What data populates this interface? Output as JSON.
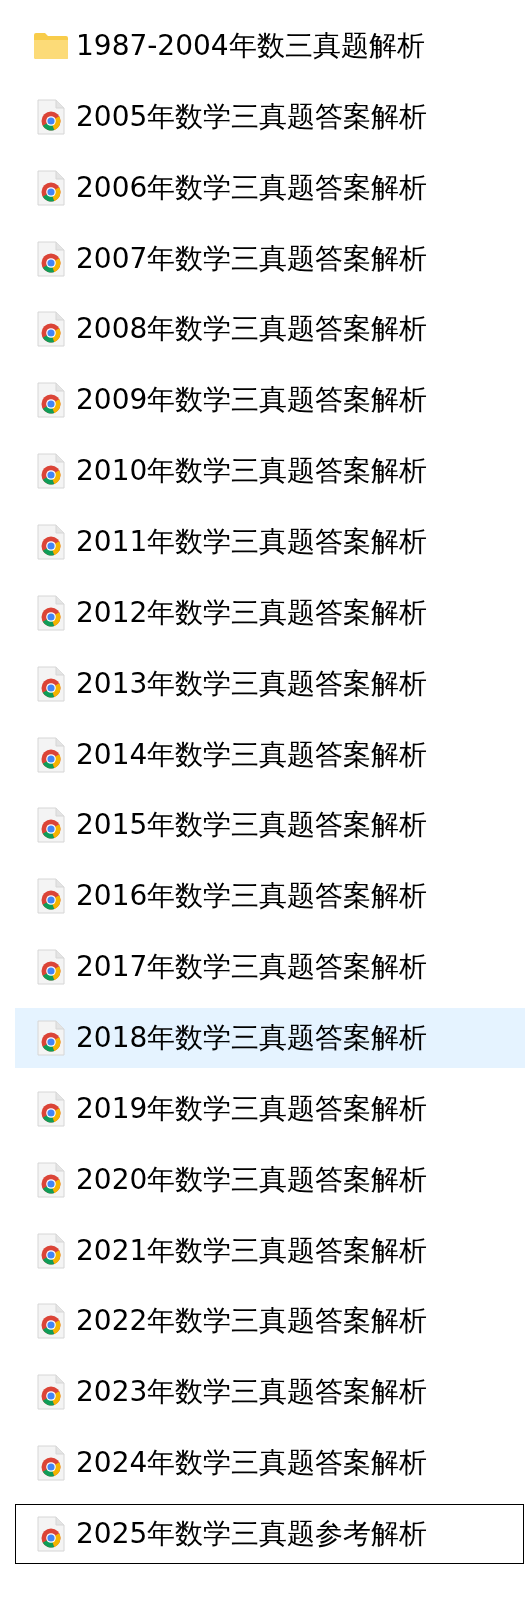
{
  "files": [
    {
      "name": "1987-2004年数三真题解析",
      "kind": "folder",
      "selected": false,
      "focused": false
    },
    {
      "name": "2005年数学三真题答案解析",
      "kind": "document",
      "selected": false,
      "focused": false
    },
    {
      "name": "2006年数学三真题答案解析",
      "kind": "document",
      "selected": false,
      "focused": false
    },
    {
      "name": "2007年数学三真题答案解析",
      "kind": "document",
      "selected": false,
      "focused": false
    },
    {
      "name": "2008年数学三真题答案解析",
      "kind": "document",
      "selected": false,
      "focused": false
    },
    {
      "name": "2009年数学三真题答案解析",
      "kind": "document",
      "selected": false,
      "focused": false
    },
    {
      "name": "2010年数学三真题答案解析",
      "kind": "document",
      "selected": false,
      "focused": false
    },
    {
      "name": "2011年数学三真题答案解析",
      "kind": "document",
      "selected": false,
      "focused": false
    },
    {
      "name": "2012年数学三真题答案解析",
      "kind": "document",
      "selected": false,
      "focused": false
    },
    {
      "name": "2013年数学三真题答案解析",
      "kind": "document",
      "selected": false,
      "focused": false
    },
    {
      "name": "2014年数学三真题答案解析",
      "kind": "document",
      "selected": false,
      "focused": false
    },
    {
      "name": "2015年数学三真题答案解析",
      "kind": "document",
      "selected": false,
      "focused": false
    },
    {
      "name": "2016年数学三真题答案解析",
      "kind": "document",
      "selected": false,
      "focused": false
    },
    {
      "name": "2017年数学三真题答案解析",
      "kind": "document",
      "selected": false,
      "focused": false
    },
    {
      "name": "2018年数学三真题答案解析",
      "kind": "document",
      "selected": true,
      "focused": false
    },
    {
      "name": "2019年数学三真题答案解析",
      "kind": "document",
      "selected": false,
      "focused": false
    },
    {
      "name": "2020年数学三真题答案解析",
      "kind": "document",
      "selected": false,
      "focused": false
    },
    {
      "name": "2021年数学三真题答案解析",
      "kind": "document",
      "selected": false,
      "focused": false
    },
    {
      "name": "2022年数学三真题答案解析",
      "kind": "document",
      "selected": false,
      "focused": false
    },
    {
      "name": "2023年数学三真题答案解析",
      "kind": "document",
      "selected": false,
      "focused": false
    },
    {
      "name": "2024年数学三真题答案解析",
      "kind": "document",
      "selected": false,
      "focused": false
    },
    {
      "name": "2025年数学三真题参考解析",
      "kind": "document",
      "selected": false,
      "focused": true
    }
  ]
}
